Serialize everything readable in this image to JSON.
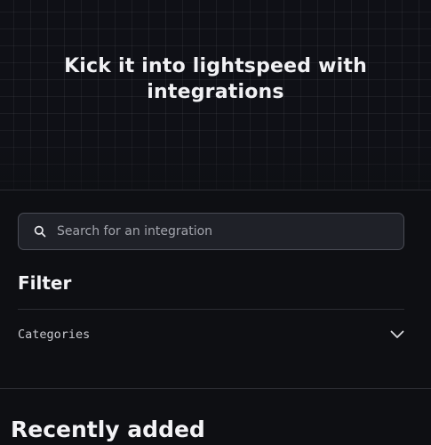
{
  "hero": {
    "title": "Kick it into lightspeed with integrations"
  },
  "search": {
    "placeholder": "Search for an integration",
    "value": "",
    "icon": "search-icon"
  },
  "filter": {
    "title": "Filter",
    "categories_label": "Categories",
    "categories_icon": "chevron-down-icon"
  },
  "recent": {
    "title": "Recently added"
  },
  "colors": {
    "background": "#0e0f13",
    "input_background": "#1f2128",
    "input_border": "#4a4c55",
    "text": "#ededf0",
    "muted_text": "#a3a5ad"
  }
}
